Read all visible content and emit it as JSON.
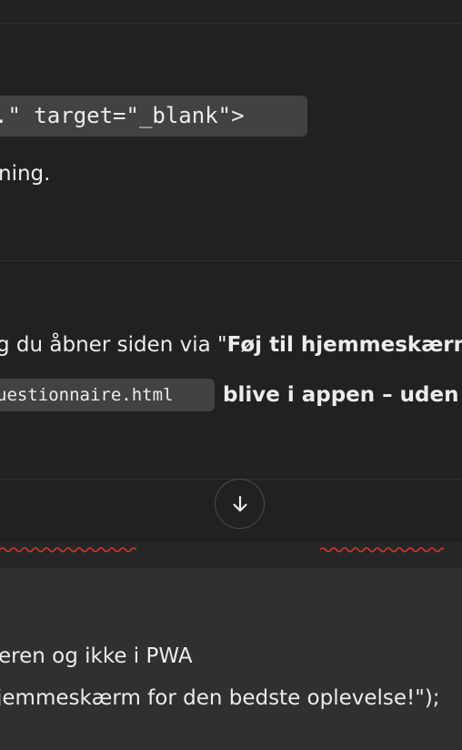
{
  "chat": {
    "code_snippet_top": ".\" target=\"_blank\">",
    "line_ning": "ning.",
    "line_pwa_prefix": "g du åbner siden via \"",
    "line_pwa_bold": "Føj til hjemmeskærm",
    "code_inline": "uestionnaire.html",
    "line_blive": "blive i appen – uden"
  },
  "scroll_button": {
    "icon": "arrow-down-icon"
  },
  "editor": {
    "line_1": "eren og ikke i PWA",
    "line_2": "jemmeskærm for den bedste oplevelse!\");"
  },
  "colors": {
    "background": "#212121",
    "code_chip": "#424242",
    "editor_background": "#303030",
    "spellcheck_underline": "#e0342c",
    "text": "#ececec"
  }
}
